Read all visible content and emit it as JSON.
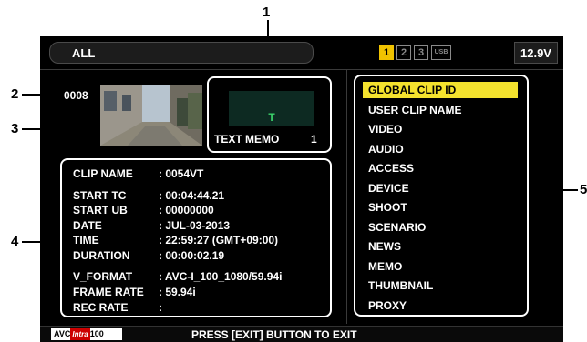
{
  "topbar": {
    "filter_label": "ALL",
    "slots": [
      "1",
      "2",
      "3",
      "USB"
    ],
    "active_slot": "1",
    "voltage": "12.9V"
  },
  "clip": {
    "number": "0008",
    "text_memo_preview": "T",
    "text_memo_label": "TEXT MEMO",
    "text_memo_count": "1"
  },
  "info": [
    {
      "label": "CLIP NAME",
      "value": ": 0054VT"
    },
    {
      "label": "START TC",
      "value": ": 00:04:44.21"
    },
    {
      "label": "START UB",
      "value": ": 00000000"
    },
    {
      "label": "DATE",
      "value": ": JUL-03-2013"
    },
    {
      "label": "TIME",
      "value": ": 22:59:27 (GMT+09:00)"
    },
    {
      "label": "DURATION",
      "value": ": 00:00:02.19"
    },
    {
      "label": "V_FORMAT",
      "value": ": AVC-I_100_1080/59.94i"
    },
    {
      "label": "FRAME RATE",
      "value": ": 59.94i"
    },
    {
      "label": "REC RATE",
      "value": ":"
    }
  ],
  "menu": {
    "items": [
      "GLOBAL CLIP ID",
      "USER CLIP NAME",
      "VIDEO",
      "AUDIO",
      "ACCESS",
      "DEVICE",
      "SHOOT",
      "SCENARIO",
      "NEWS",
      "MEMO",
      "THUMBNAIL",
      "PROXY"
    ],
    "selected": "GLOBAL CLIP ID"
  },
  "bottombar": {
    "codec_left": "AVC",
    "codec_mid": "Intra",
    "codec_right": "100",
    "exit_message": "PRESS [EXIT] BUTTON TO EXIT"
  },
  "callouts": {
    "c1": "1",
    "c2": "2",
    "c3": "3",
    "c4": "4",
    "c5": "5"
  },
  "colors": {
    "selected_highlight": "#f4e22e",
    "active_slot": "#f0c300",
    "memo_text": "#3ad06a",
    "screen_bg": "#000000"
  }
}
